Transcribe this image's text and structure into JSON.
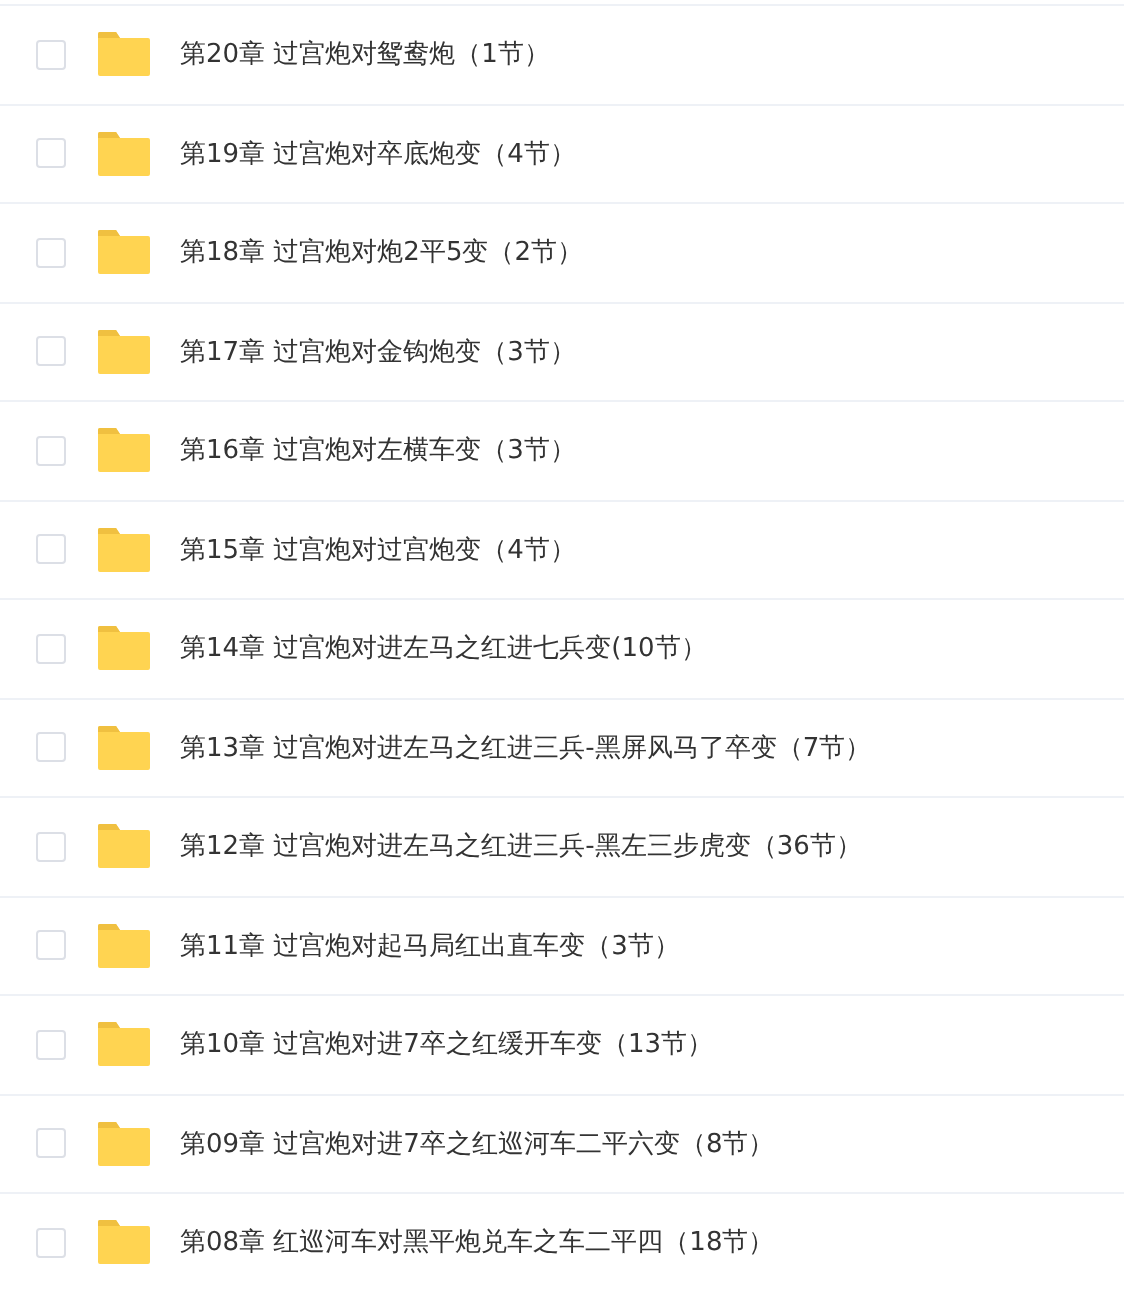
{
  "chapters": [
    {
      "title": "第20章 过宫炮对鸳鸯炮（1节）",
      "checked": false
    },
    {
      "title": "第19章 过宫炮对卒底炮变（4节）",
      "checked": false
    },
    {
      "title": "第18章 过宫炮对炮2平5变（2节）",
      "checked": false
    },
    {
      "title": "第17章 过宫炮对金钩炮变（3节）",
      "checked": false
    },
    {
      "title": "第16章 过宫炮对左横车变（3节）",
      "checked": false
    },
    {
      "title": "第15章 过宫炮对过宫炮变（4节）",
      "checked": false
    },
    {
      "title": "第14章 过宫炮对进左马之红进七兵变(10节）",
      "checked": false
    },
    {
      "title": "第13章 过宫炮对进左马之红进三兵-黑屏风马了卒变（7节）",
      "checked": false
    },
    {
      "title": "第12章 过宫炮对进左马之红进三兵-黑左三步虎变（36节）",
      "checked": false
    },
    {
      "title": "第11章 过宫炮对起马局红出直车变（3节）",
      "checked": false
    },
    {
      "title": "第10章 过宫炮对进7卒之红缓开车变（13节）",
      "checked": false
    },
    {
      "title": "第09章 过宫炮对进7卒之红巡河车二平六变（8节）",
      "checked": false
    },
    {
      "title": "第08章 红巡河车对黑平炮兑车之车二平四（18节）",
      "checked": false
    }
  ]
}
